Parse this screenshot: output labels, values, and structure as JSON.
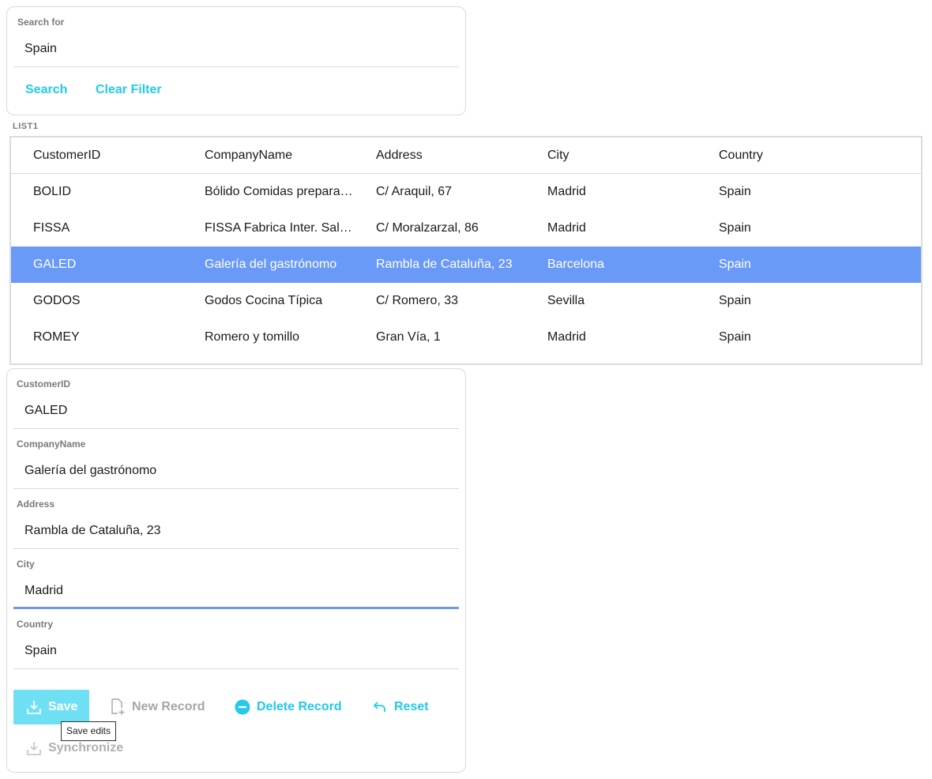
{
  "search": {
    "label": "Search for",
    "value": "Spain",
    "search_label": "Search",
    "clear_label": "Clear Filter"
  },
  "list": {
    "label": "LIST1",
    "columns": [
      "CustomerID",
      "CompanyName",
      "Address",
      "City",
      "Country"
    ],
    "rows": [
      [
        "BOLID",
        "Bólido Comidas preparadas",
        "C/ Araquil, 67",
        "Madrid",
        "Spain"
      ],
      [
        "FISSA",
        "FISSA Fabrica Inter. Salchichas S.A.",
        "C/ Moralzarzal, 86",
        "Madrid",
        "Spain"
      ],
      [
        "GALED",
        "Galería del gastrónomo",
        "Rambla de Cataluña, 23",
        "Barcelona",
        "Spain"
      ],
      [
        "GODOS",
        "Godos Cocina Típica",
        "C/ Romero, 33",
        "Sevilla",
        "Spain"
      ],
      [
        "ROMEY",
        "Romero y tomillo",
        "Gran Vía, 1",
        "Madrid",
        "Spain"
      ]
    ],
    "selected_index": 2
  },
  "detail": {
    "fields": [
      {
        "label": "CustomerID",
        "value": "GALED"
      },
      {
        "label": "CompanyName",
        "value": "Galería del gastrónomo"
      },
      {
        "label": "Address",
        "value": "Rambla de Cataluña, 23"
      },
      {
        "label": "City",
        "value": "Madrid"
      },
      {
        "label": "Country",
        "value": "Spain"
      }
    ],
    "active_field_index": 3
  },
  "actions": {
    "save_label": "Save",
    "new_record_label": "New Record",
    "delete_record_label": "Delete Record",
    "reset_label": "Reset",
    "synchronize_label": "Synchronize",
    "save_tooltip": "Save edits"
  },
  "colors": {
    "accent": "#22c9ea",
    "selected_row": "#6a9af7",
    "active_underline": "#6d9af0",
    "save_button": "#6fe0f4",
    "disabled": "#a6a6a6"
  }
}
